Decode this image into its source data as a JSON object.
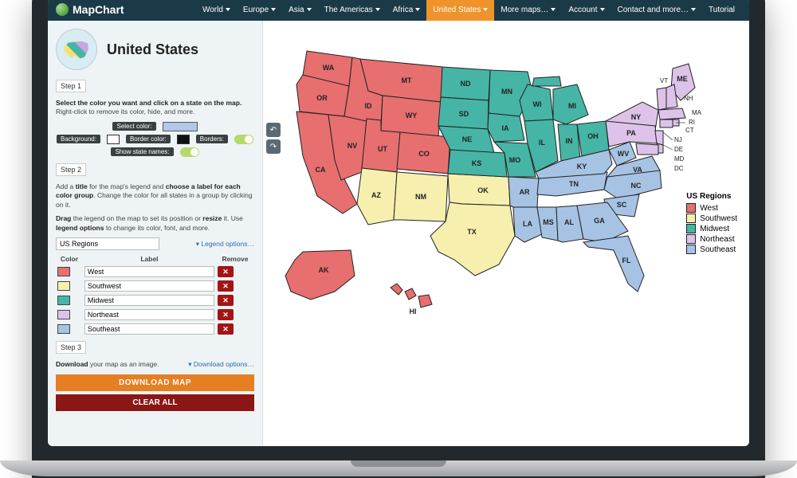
{
  "brand": "MapChart",
  "nav": {
    "items": [
      "World",
      "Europe",
      "Asia",
      "The Americas",
      "Africa",
      "United States",
      "More maps…",
      "Account",
      "Contact and more…",
      "Tutorial"
    ],
    "active_index": 5
  },
  "page": {
    "title": "United States"
  },
  "step1": {
    "header": "Step 1",
    "help_bold": "Select the color you want and click on a state on the map.",
    "help_rest": " Right-click to remove its color, hide, and more.",
    "select_color_label": "Select color:",
    "background_label": "Background:",
    "border_color_label": "Border color:",
    "borders_label": "Borders:",
    "show_names_label": "Show state names:",
    "colors": {
      "select": "#b3c7e6",
      "background": "#ffffff",
      "border": "#111111"
    }
  },
  "step2": {
    "header": "Step 2",
    "help1_a": "Add a ",
    "help1_b": "title",
    "help1_c": " for the map's legend and ",
    "help1_d": "choose a label for each color group",
    "help1_e": ". Change the color for all states in a group by clicking on it.",
    "help2_a": "Drag",
    "help2_b": " the legend on the map to set its position or ",
    "help2_c": "resize",
    "help2_d": " it. Use ",
    "help2_e": "legend options",
    "help2_f": " to change its color, font, and more.",
    "legend_title_value": "US Regions",
    "legend_options_link": "Legend options…",
    "table_headers": {
      "color": "Color",
      "label": "Label",
      "remove": "Remove"
    },
    "groups": [
      {
        "color": "#e76f6f",
        "label": "West"
      },
      {
        "color": "#f6efae",
        "label": "Southwest"
      },
      {
        "color": "#46b5a6",
        "label": "Midwest"
      },
      {
        "color": "#ddc3ea",
        "label": "Northeast"
      },
      {
        "color": "#a7c3e4",
        "label": "Southeast"
      }
    ]
  },
  "step3": {
    "header": "Step 3",
    "help_bold": "Download",
    "help_rest": " your map as an image.",
    "download_options_link": "Download options…",
    "download_button": "DOWNLOAD MAP",
    "clear_button": "CLEAR ALL"
  },
  "legend": {
    "title": "US Regions",
    "items": [
      {
        "color": "#e76f6f",
        "label": "West"
      },
      {
        "color": "#f6efae",
        "label": "Southwest"
      },
      {
        "color": "#46b5a6",
        "label": "Midwest"
      },
      {
        "color": "#ddc3ea",
        "label": "Northeast"
      },
      {
        "color": "#a7c3e4",
        "label": "Southeast"
      }
    ]
  },
  "colors": {
    "west": "#e76f6f",
    "southwest": "#f6efae",
    "midwest": "#46b5a6",
    "northeast": "#ddc3ea",
    "southeast": "#a7c3e4"
  },
  "states": {
    "WA": "WA",
    "OR": "OR",
    "CA": "CA",
    "NV": "NV",
    "ID": "ID",
    "MT": "MT",
    "WY": "WY",
    "UT": "UT",
    "CO": "CO",
    "AZ": "AZ",
    "NM": "NM",
    "ND": "ND",
    "SD": "SD",
    "NE": "NE",
    "KS": "KS",
    "MN": "MN",
    "IA": "IA",
    "MO": "MO",
    "WI": "WI",
    "IL": "IL",
    "MI": "MI",
    "IN": "IN",
    "OH": "OH",
    "OK": "OK",
    "TX": "TX",
    "AR": "AR",
    "LA": "LA",
    "MS": "MS",
    "AL": "AL",
    "TN": "TN",
    "KY": "KY",
    "WV": "WV",
    "VA": "VA",
    "NC": "NC",
    "SC": "SC",
    "GA": "GA",
    "FL": "FL",
    "ME": "ME",
    "NY": "NY",
    "PA": "PA",
    "VT": "VT",
    "NH": "NH",
    "MA": "MA",
    "RI": "RI",
    "CT": "CT",
    "NJ": "NJ",
    "DE": "DE",
    "MD": "MD",
    "DC": "DC",
    "AK": "AK",
    "HI": "HI"
  }
}
